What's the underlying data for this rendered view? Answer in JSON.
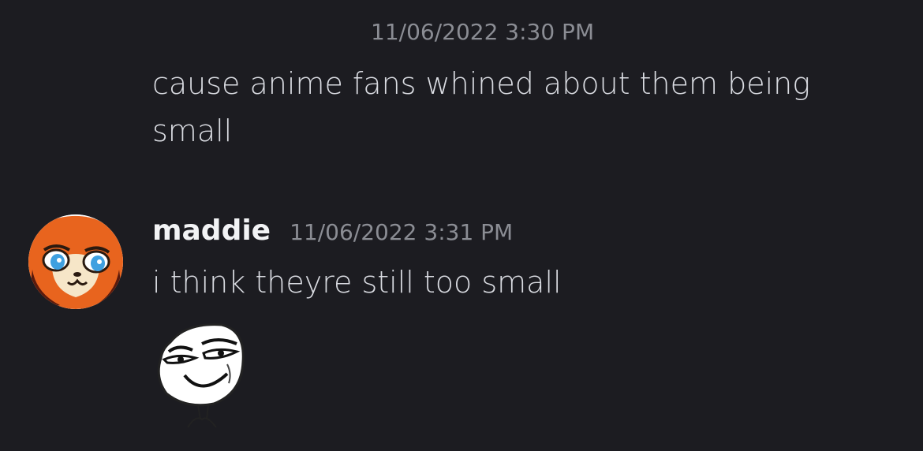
{
  "messages": [
    {
      "timestamp": "11/06/2022 3:30 PM",
      "text": "cause anime fans whined about them being small"
    },
    {
      "username": "maddie",
      "timestamp": "11/06/2022 3:31 PM",
      "text": "i think theyre still too small",
      "avatar_icon": "fox-avatar-icon",
      "sticker_icon": "smug-face-sticker-icon"
    }
  ],
  "colors": {
    "background": "#1c1c21",
    "text": "#dadce2",
    "muted": "#8b8d94",
    "username": "#f2f3f5",
    "avatar_orange": "#e8641e"
  }
}
